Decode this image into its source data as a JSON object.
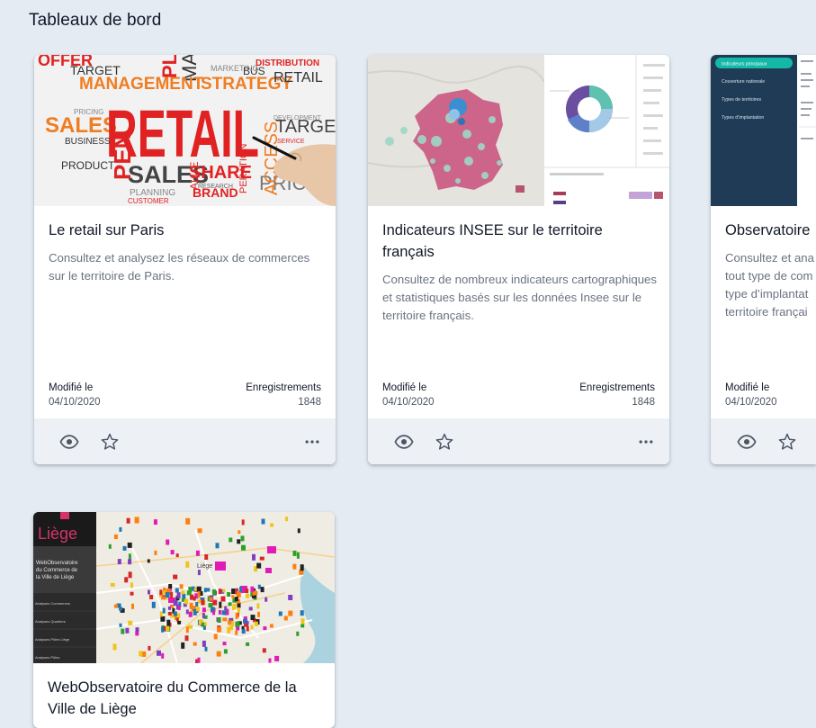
{
  "section": {
    "title": "Tableaux de bord"
  },
  "cards": [
    {
      "title": "Le retail sur Paris",
      "description": "Consultez et analysez les réseaux de commerces sur le territoire de Paris.",
      "modified_label": "Modifié le",
      "modified_value": "04/10/2020",
      "records_label": "Enregistrements",
      "records_value": "1848",
      "thumb_words": [
        "OFFER",
        "TARGET",
        "PL",
        "MAR",
        "BUS",
        "DISTRIBUTION",
        "MANAGEMENT",
        "STRATEGY",
        "RETAIL",
        "SALES",
        "RETAIL",
        "TARGET",
        "BUSINESS",
        "PRODUCT",
        "SALES",
        "SHARE",
        "PEN",
        "BRAND",
        "PLANNING",
        "PRICE",
        "CUSTOMER",
        "MARKETING",
        "PRICING",
        "RESEARCH",
        "SERVICE",
        "ALUE",
        "ACCESS",
        "PERATION",
        "DEVELOPMENT"
      ]
    },
    {
      "title": "Indicateurs INSEE sur le territoire français",
      "description": "Consultez de nombreux indicateurs cartographiques et statistiques basés sur les données Insee sur le territoire français.",
      "modified_label": "Modifié le",
      "modified_value": "04/10/2020",
      "records_label": "Enregistrements",
      "records_value": "1848"
    },
    {
      "title": "Observatoire",
      "description_lines": [
        "Consultez et ana",
        "tout type de com",
        "type d’implantat",
        "territoire françai"
      ],
      "modified_label": "Modifié le",
      "modified_value": "04/10/2020",
      "thumb_menu": [
        "Indicateurs principaux",
        "Couverture nationale",
        "Types de territoires",
        "Types d’implantation"
      ]
    },
    {
      "title_lines": [
        "WebObservatoire du Commerce de la",
        "Ville de Liège"
      ],
      "thumb_logo": "Liège",
      "thumb_subtitle": [
        "WebObservatoire",
        "du Commerce de",
        "la Ville de Liège"
      ],
      "thumb_menu": [
        "Analyses Commerces",
        "Analyses Quartiers",
        "Analyses Pôles Liège",
        "Analyses Pôles"
      ],
      "thumb_map_label": "Liège"
    }
  ],
  "icons": {
    "view": "eye-icon",
    "favorite": "star-outline-icon",
    "more": "more-horizontal-icon"
  },
  "colors": {
    "background": "#e4ebf3",
    "footer": "#edf1f6",
    "retail_red": "#e02222",
    "retail_orange": "#ef7d22",
    "dark_blue": "#1f3b55",
    "teal_active": "#14b8a6"
  }
}
